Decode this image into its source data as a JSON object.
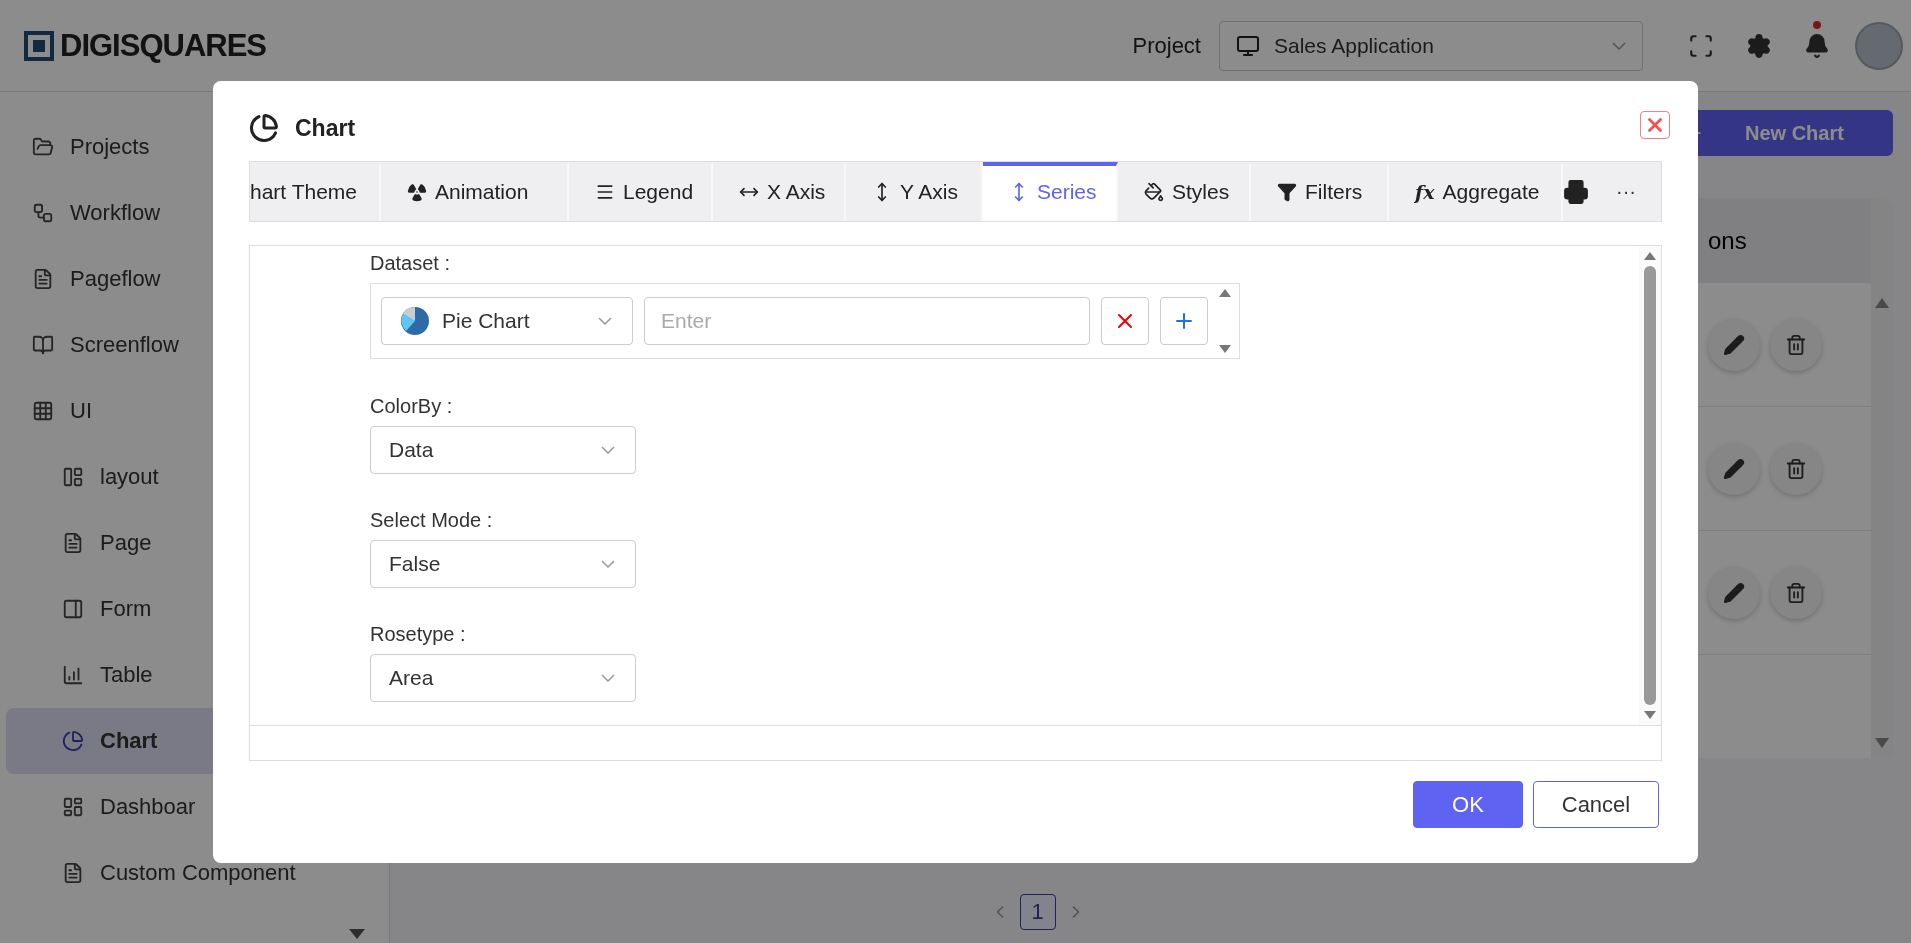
{
  "header": {
    "logo": "DIGISQUARES",
    "project_label": "Project",
    "project_value": "Sales Application",
    "notification_dot": true
  },
  "sidebar": {
    "items": [
      {
        "label": "Projects",
        "selected": false
      },
      {
        "label": "Workflow",
        "selected": false
      },
      {
        "label": "Pageflow",
        "selected": false
      },
      {
        "label": "Screenflow",
        "selected": false
      },
      {
        "label": "UI",
        "selected": false,
        "children": [
          {
            "label": "layout",
            "selected": false
          },
          {
            "label": "Page",
            "selected": false
          },
          {
            "label": "Form",
            "selected": false
          },
          {
            "label": "Table",
            "selected": false
          },
          {
            "label": "Chart",
            "selected": true
          },
          {
            "label": "Dashboar",
            "selected": false
          },
          {
            "label": "Custom Component",
            "selected": false
          }
        ]
      }
    ]
  },
  "main": {
    "new_button": "New Chart",
    "table_header": "ons",
    "rows": [
      {
        "kind": "actions"
      },
      {
        "kind": "actions"
      },
      {
        "kind": "actions"
      }
    ],
    "pagination": [
      {
        "label": "1",
        "selected": true
      }
    ]
  },
  "dialog": {
    "title": "Chart",
    "tabs": [
      {
        "label": "hart Theme",
        "selected": false
      },
      {
        "label": "Animation",
        "selected": false
      },
      {
        "label": "Legend",
        "selected": false
      },
      {
        "label": "X Axis",
        "selected": false
      },
      {
        "label": "Y Axis",
        "selected": false
      },
      {
        "label": "Series",
        "selected": true
      },
      {
        "label": "Styles",
        "selected": false
      },
      {
        "label": "Filters",
        "selected": false
      },
      {
        "label": "Aggregate",
        "icon_text": "fx",
        "selected": false
      }
    ],
    "overflow_button": "···",
    "dataset": {
      "label": "Dataset :",
      "type": "Pie Chart",
      "placeholder": "Enter"
    },
    "fields": [
      {
        "label": "ColorBy :",
        "value": "Data"
      },
      {
        "label": "Select Mode :",
        "value": "False"
      },
      {
        "label": "Rosetype :",
        "value": "Area"
      }
    ],
    "buttons": [
      {
        "label": "OK",
        "kind": "primary"
      },
      {
        "label": "Cancel",
        "kind": "secondary"
      }
    ]
  }
}
